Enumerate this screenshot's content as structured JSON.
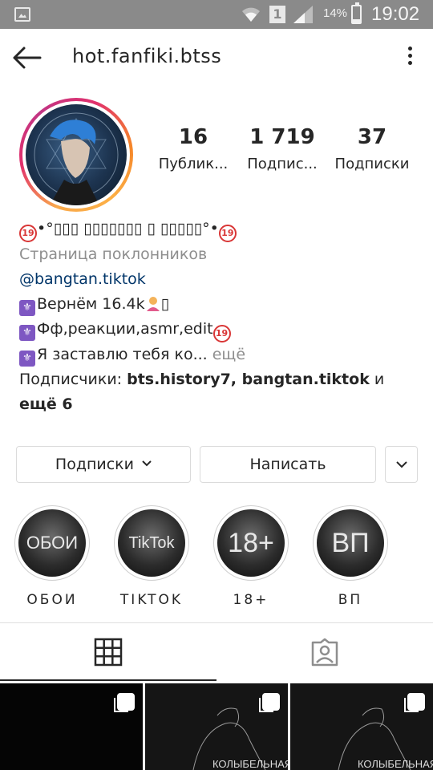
{
  "status_bar": {
    "battery_percent": "14%",
    "time": "19:02",
    "sim_label": "1"
  },
  "header": {
    "username": "hot.fanfiki.btss"
  },
  "profile": {
    "stats": [
      {
        "value": "16",
        "label": "Публик..."
      },
      {
        "value": "1 719",
        "label": "Подпис..."
      },
      {
        "value": "37",
        "label": "Подписки"
      }
    ]
  },
  "bio": {
    "name_text": "•°▯▯▯ ▯▯▯▯▯▯▯ ▯ ▯▯▯▯▯°•",
    "category": "Страница поклонников",
    "link": "@bangtan.tiktok",
    "line1": "Вернём 16.4k",
    "line1_tail": "▯",
    "line2": "Фф,реакции,asmr,edit",
    "line3": "Я заставлю тебя ко...",
    "more": "ещё",
    "followers_prefix": "Подписчики:",
    "followers_names": "bts.history7, bangtan.tiktok",
    "followers_and": "и",
    "followers_more": "ещё 6"
  },
  "actions": {
    "following_label": "Подписки",
    "message_label": "Написать"
  },
  "highlights": [
    {
      "cover_text": "ОБОИ",
      "label": "ОБОИ"
    },
    {
      "cover_text": "TikTok",
      "label": "TIKTOK"
    },
    {
      "cover_text": "18+",
      "label": "18+"
    },
    {
      "cover_text": "ВП",
      "label": "ВП"
    }
  ],
  "grid": {
    "captions": [
      "",
      "КОЛЫБЕЛЬНАЯ",
      "КОЛЫБЕЛЬНАЯ"
    ]
  }
}
